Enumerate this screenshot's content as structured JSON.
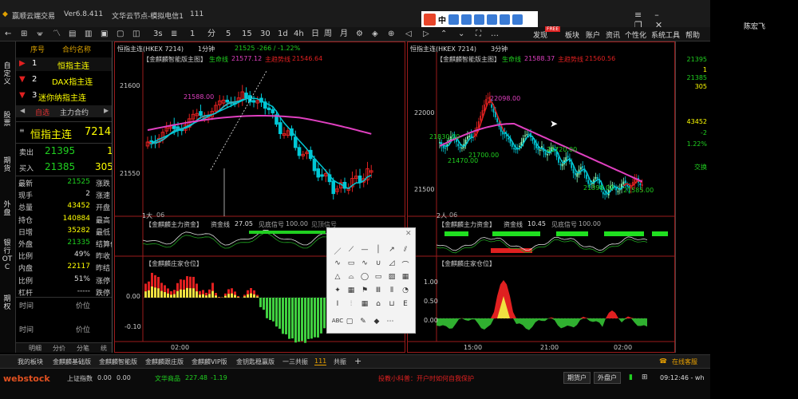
{
  "titlebar": {
    "app_name": "赢顺云端交易",
    "version": "Ver6.8.411",
    "server": "文华云节点-模拟电信1",
    "account_no": "111",
    "ime_label": "中"
  },
  "user_panel": {
    "name": "陈宏飞"
  },
  "toolbar": {
    "periods": [
      "分",
      "5",
      "15",
      "30",
      "1d",
      "4h",
      "日",
      "周",
      "月"
    ],
    "discover_label": "发现",
    "discover_badge": "FREE",
    "menus": [
      "板块",
      "账户",
      "资讯",
      "个性化",
      "系统工具",
      "帮助"
    ]
  },
  "left_tabs": [
    "自定义",
    "股票",
    "期货",
    "外盘",
    "银行OTC",
    "期权"
  ],
  "watchlist": {
    "headers": {
      "seq": "序号",
      "name": "合约名称"
    },
    "items": [
      {
        "seq": "1",
        "name": "恒指主连"
      },
      {
        "seq": "2",
        "name": "DAX指主连"
      },
      {
        "seq": "3",
        "name": "迷你纳指主连"
      }
    ],
    "tabs": [
      "自选",
      "主力合约"
    ],
    "quote_title": "恒指主连",
    "quote_price_partial": "7214",
    "sell_label": "卖出",
    "sell_price": "21395",
    "sell_vol": "1",
    "buy_label": "买入",
    "buy_price": "21385",
    "buy_vol": "305",
    "stats": [
      {
        "l": "最新",
        "v": "21525",
        "l2": "涨跌"
      },
      {
        "l": "现手",
        "v": "2",
        "l2": "涨速"
      },
      {
        "l": "总量",
        "v": "43452",
        "l2": "开盘"
      },
      {
        "l": "持仓",
        "v": "140884",
        "l2": "最高"
      },
      {
        "l": "日增",
        "v": "35282",
        "l2": "最低"
      },
      {
        "l": "外盘",
        "v": "21335",
        "l2": "结算价"
      },
      {
        "l": "比例",
        "v": "49%",
        "l2": "昨收"
      },
      {
        "l": "内盘",
        "v": "22117",
        "l2": "昨结"
      },
      {
        "l": "比例",
        "v": "51%",
        "l2": "涨停"
      },
      {
        "l": "杠杆",
        "v": "-----",
        "l2": "跌停"
      }
    ],
    "trade_headers": [
      {
        "time": "时间",
        "price": "价位"
      },
      {
        "time": "时间",
        "price": "价位"
      }
    ],
    "bottom_tabs": [
      "明细",
      "分价",
      "分笔",
      "统"
    ]
  },
  "chart1": {
    "title": "恒指主连(HKEX 7214)",
    "period": "1分钟",
    "last": "21525",
    "change": "-266 / -1.22%",
    "indicator": "【金麒麟智能版主图】",
    "lifeline_label": "生命线",
    "lifeline_value": "21577.12",
    "trend_label": "主趋势线",
    "trend_value": "21546.64",
    "y_ticks": [
      "21600",
      "21550"
    ],
    "marker_label": "21588.00",
    "corner_label": "1大",
    "date_label": "06",
    "sub1": {
      "title": "【金麒麟主力资金】",
      "fund_label": "资金线",
      "fund_value": "27.05",
      "power_label": "见底信号",
      "power_value": "100.00",
      "extra_label": "见顶信号"
    },
    "sub2": {
      "title": "【金麒麟庄家仓位】",
      "y_ticks": [
        "0.00",
        "-0.10"
      ]
    },
    "time_labels": [
      "02:00"
    ]
  },
  "chart2": {
    "title": "恒指主连(HKEX 7214)",
    "period": "3分钟",
    "indicator": "【金麒麟智能版主图】",
    "lifeline_label": "生命线",
    "lifeline_value": "21588.37",
    "trend_label": "主趋势线",
    "trend_value": "21560.56",
    "y_ticks": [
      "22000",
      "21500"
    ],
    "labels": [
      "22098.00",
      "21830.00",
      "21700.00",
      "21470.00",
      "21720.00",
      "21398.00",
      "21585.00"
    ],
    "corner_label": "2人",
    "date_label": "06",
    "sub1": {
      "title": "【金麒麟主力资金】",
      "fund_label": "资金线",
      "fund_value": "10.45",
      "power_label": "见底信号",
      "power_value": "100.00"
    },
    "sub2": {
      "title": "【金麒麟庄家仓位】",
      "y_ticks": [
        "1.00",
        "0.50",
        "0.00"
      ]
    },
    "time_labels": [
      "15:00",
      "21:00",
      "02:00"
    ]
  },
  "right_sidebar": {
    "values": [
      "21395",
      "1",
      "21385",
      "305",
      "43452",
      "-2",
      "1.22%",
      "交换"
    ]
  },
  "draw_tool": {
    "text_label": "ABC"
  },
  "bottom_tabs": [
    "我的板块",
    "金麒麟基础版",
    "金麒麟智能版",
    "金麒麟跟庄版",
    "金麒麟VIP版",
    "金钥匙稳赢版",
    "一三共振",
    "111",
    "共振",
    "+"
  ],
  "online_service": "在线客服",
  "status": {
    "logo": "webstock",
    "index_label": "上证指数",
    "index_value": "0.00",
    "index_change": "0.00",
    "commodity_label": "文华商品",
    "commodity_value": "227.48",
    "commodity_change": "-1.19",
    "ticker_text": "投教小科普：开户时如何自我保护",
    "account_btn1": "期货户",
    "account_btn2": "外盘户",
    "time": "09:12:46 - wh"
  },
  "colors": {
    "up": "#e02020",
    "down": "#00c8d6",
    "green": "#20d020",
    "yellow": "#f0e040",
    "magenta": "#e040c0",
    "border": "#9b1b1b"
  }
}
